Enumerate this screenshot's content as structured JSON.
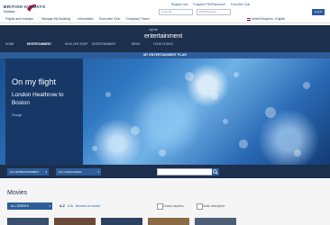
{
  "brand": {
    "name": "BRITISH AIRWAYS",
    "sub": "Holidays"
  },
  "toplinks": [
    "Register now",
    "Forgotten PIN/Password?",
    "Executive Club"
  ],
  "login": {
    "label": "",
    "id_placeholder": "Login ID",
    "pin_placeholder": "PIN/Password",
    "button": "Log in"
  },
  "globalnav": [
    "Flights and holidays",
    "Manage My Booking",
    "Information",
    "Executive Club",
    "Company Travel"
  ],
  "country": "United Kingdom - English",
  "entertainment": {
    "small_label": "highlife",
    "title": "entertainment"
  },
  "tabs": [
    "HOME",
    "ENTERTAINMENT",
    "HIGH LIFE SHOP",
    "ENTERTAINMENT",
    "NEWS",
    "FOOD CHOICE"
  ],
  "planbar": "MY ENTERTAINMENT PLAN",
  "hero": {
    "title": "On my flight",
    "route": "London Heathrow to Boston",
    "credit": "Change"
  },
  "filters": {
    "entertainment_btn": "ALL ENTERTAINMENT",
    "languages_btn": "ALL LANGUAGES",
    "search_placeholder": ""
  },
  "movies": {
    "title": "Movies",
    "genre_btn": "ALL GENRES",
    "sort_az": "A-Z",
    "sort_za": "Z-A",
    "sort_recent": "Newest on board",
    "closed_captions": "Closed captions",
    "audio_description": "Audio description"
  },
  "colors": {
    "navy": "#1c2f4d",
    "accent": "#2d5e9a"
  }
}
